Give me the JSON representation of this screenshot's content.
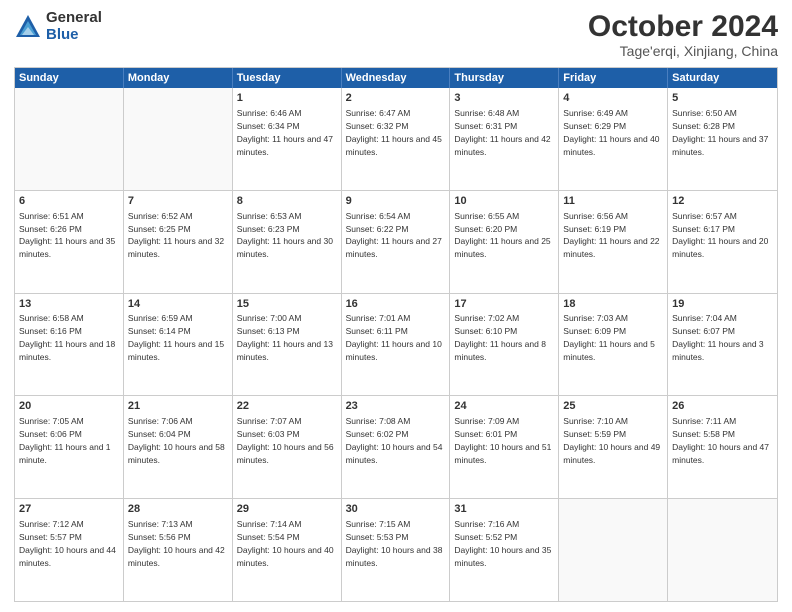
{
  "header": {
    "logo_general": "General",
    "logo_blue": "Blue",
    "title": "October 2024",
    "location": "Tage'erqi, Xinjiang, China"
  },
  "weekdays": [
    "Sunday",
    "Monday",
    "Tuesday",
    "Wednesday",
    "Thursday",
    "Friday",
    "Saturday"
  ],
  "weeks": [
    [
      {
        "day": "",
        "text": ""
      },
      {
        "day": "",
        "text": ""
      },
      {
        "day": "1",
        "text": "Sunrise: 6:46 AM\nSunset: 6:34 PM\nDaylight: 11 hours and 47 minutes."
      },
      {
        "day": "2",
        "text": "Sunrise: 6:47 AM\nSunset: 6:32 PM\nDaylight: 11 hours and 45 minutes."
      },
      {
        "day": "3",
        "text": "Sunrise: 6:48 AM\nSunset: 6:31 PM\nDaylight: 11 hours and 42 minutes."
      },
      {
        "day": "4",
        "text": "Sunrise: 6:49 AM\nSunset: 6:29 PM\nDaylight: 11 hours and 40 minutes."
      },
      {
        "day": "5",
        "text": "Sunrise: 6:50 AM\nSunset: 6:28 PM\nDaylight: 11 hours and 37 minutes."
      }
    ],
    [
      {
        "day": "6",
        "text": "Sunrise: 6:51 AM\nSunset: 6:26 PM\nDaylight: 11 hours and 35 minutes."
      },
      {
        "day": "7",
        "text": "Sunrise: 6:52 AM\nSunset: 6:25 PM\nDaylight: 11 hours and 32 minutes."
      },
      {
        "day": "8",
        "text": "Sunrise: 6:53 AM\nSunset: 6:23 PM\nDaylight: 11 hours and 30 minutes."
      },
      {
        "day": "9",
        "text": "Sunrise: 6:54 AM\nSunset: 6:22 PM\nDaylight: 11 hours and 27 minutes."
      },
      {
        "day": "10",
        "text": "Sunrise: 6:55 AM\nSunset: 6:20 PM\nDaylight: 11 hours and 25 minutes."
      },
      {
        "day": "11",
        "text": "Sunrise: 6:56 AM\nSunset: 6:19 PM\nDaylight: 11 hours and 22 minutes."
      },
      {
        "day": "12",
        "text": "Sunrise: 6:57 AM\nSunset: 6:17 PM\nDaylight: 11 hours and 20 minutes."
      }
    ],
    [
      {
        "day": "13",
        "text": "Sunrise: 6:58 AM\nSunset: 6:16 PM\nDaylight: 11 hours and 18 minutes."
      },
      {
        "day": "14",
        "text": "Sunrise: 6:59 AM\nSunset: 6:14 PM\nDaylight: 11 hours and 15 minutes."
      },
      {
        "day": "15",
        "text": "Sunrise: 7:00 AM\nSunset: 6:13 PM\nDaylight: 11 hours and 13 minutes."
      },
      {
        "day": "16",
        "text": "Sunrise: 7:01 AM\nSunset: 6:11 PM\nDaylight: 11 hours and 10 minutes."
      },
      {
        "day": "17",
        "text": "Sunrise: 7:02 AM\nSunset: 6:10 PM\nDaylight: 11 hours and 8 minutes."
      },
      {
        "day": "18",
        "text": "Sunrise: 7:03 AM\nSunset: 6:09 PM\nDaylight: 11 hours and 5 minutes."
      },
      {
        "day": "19",
        "text": "Sunrise: 7:04 AM\nSunset: 6:07 PM\nDaylight: 11 hours and 3 minutes."
      }
    ],
    [
      {
        "day": "20",
        "text": "Sunrise: 7:05 AM\nSunset: 6:06 PM\nDaylight: 11 hours and 1 minute."
      },
      {
        "day": "21",
        "text": "Sunrise: 7:06 AM\nSunset: 6:04 PM\nDaylight: 10 hours and 58 minutes."
      },
      {
        "day": "22",
        "text": "Sunrise: 7:07 AM\nSunset: 6:03 PM\nDaylight: 10 hours and 56 minutes."
      },
      {
        "day": "23",
        "text": "Sunrise: 7:08 AM\nSunset: 6:02 PM\nDaylight: 10 hours and 54 minutes."
      },
      {
        "day": "24",
        "text": "Sunrise: 7:09 AM\nSunset: 6:01 PM\nDaylight: 10 hours and 51 minutes."
      },
      {
        "day": "25",
        "text": "Sunrise: 7:10 AM\nSunset: 5:59 PM\nDaylight: 10 hours and 49 minutes."
      },
      {
        "day": "26",
        "text": "Sunrise: 7:11 AM\nSunset: 5:58 PM\nDaylight: 10 hours and 47 minutes."
      }
    ],
    [
      {
        "day": "27",
        "text": "Sunrise: 7:12 AM\nSunset: 5:57 PM\nDaylight: 10 hours and 44 minutes."
      },
      {
        "day": "28",
        "text": "Sunrise: 7:13 AM\nSunset: 5:56 PM\nDaylight: 10 hours and 42 minutes."
      },
      {
        "day": "29",
        "text": "Sunrise: 7:14 AM\nSunset: 5:54 PM\nDaylight: 10 hours and 40 minutes."
      },
      {
        "day": "30",
        "text": "Sunrise: 7:15 AM\nSunset: 5:53 PM\nDaylight: 10 hours and 38 minutes."
      },
      {
        "day": "31",
        "text": "Sunrise: 7:16 AM\nSunset: 5:52 PM\nDaylight: 10 hours and 35 minutes."
      },
      {
        "day": "",
        "text": ""
      },
      {
        "day": "",
        "text": ""
      }
    ]
  ]
}
